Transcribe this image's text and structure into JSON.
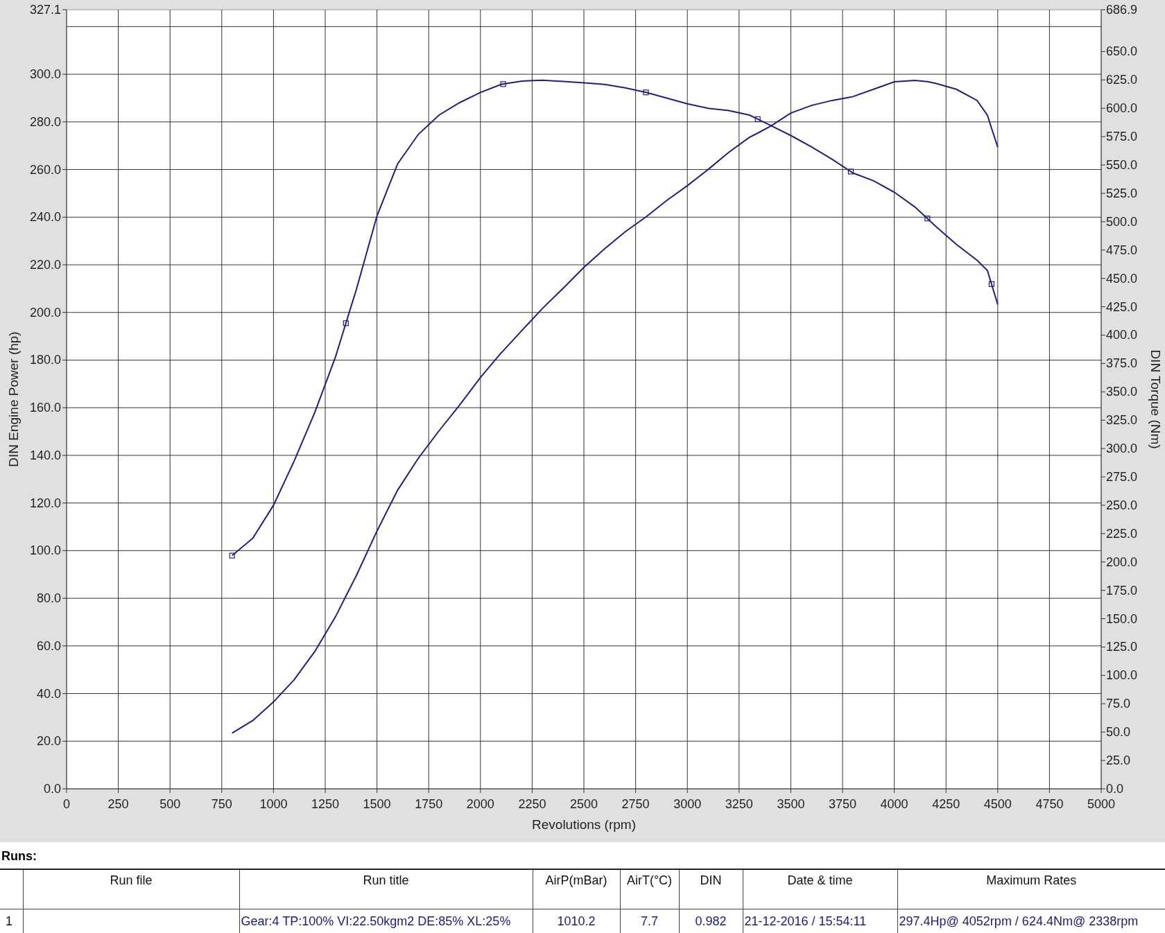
{
  "chart": {
    "chart_data": {
      "type": "line",
      "grid": true,
      "xlabel": "Revolutions (rpm)",
      "ylabel": "DIN Engine Power (hp)",
      "y2label": "DIN Torque (Nm)",
      "x": [
        800,
        900,
        1000,
        1100,
        1200,
        1300,
        1350,
        1400,
        1500,
        1600,
        1700,
        1800,
        1900,
        2000,
        2100,
        2110,
        2200,
        2300,
        2400,
        2500,
        2600,
        2700,
        2800,
        2900,
        3000,
        3100,
        3200,
        3300,
        3340,
        3400,
        3500,
        3600,
        3700,
        3790,
        3800,
        3900,
        4000,
        4100,
        4160,
        4200,
        4300,
        4400,
        4450,
        4470,
        4500
      ],
      "series": [
        {
          "axis": "y2",
          "color": "#1f1f7a",
          "values": [
            205.6,
            221,
            250,
            289,
            332,
            381,
            410.5,
            440,
            505,
            551,
            577,
            594,
            605,
            614,
            621,
            621.3,
            624,
            624.7,
            623.7,
            622.5,
            621,
            618,
            614,
            609,
            604,
            600,
            598,
            594,
            590.4,
            585,
            576,
            566,
            555,
            544.2,
            543,
            536,
            526,
            513,
            502.8,
            496,
            480,
            466,
            457,
            445,
            427
          ]
        },
        {
          "color": "#1f1f7a",
          "values": [
            23.4,
            28.7,
            36.5,
            45.8,
            57.7,
            72.3,
            80.9,
            89.5,
            108.2,
            125.4,
            138.8,
            150.3,
            161.2,
            172.7,
            183,
            183.9,
            192.4,
            201.7,
            210.2,
            218.9,
            226.7,
            233.9,
            240.1,
            247,
            253.2,
            260,
            267.2,
            273.5,
            275.3,
            278.1,
            283.7,
            286.9,
            289,
            290.4,
            290.6,
            293.7,
            296.8,
            297.4,
            296.9,
            296.2,
            293.7,
            289,
            282.8,
            277.4,
            269.4
          ]
        },
        {
          "type": "scatter",
          "axis": "y2",
          "color": "#1f1f7a",
          "values": [
            205.6,
            null,
            null,
            null,
            null,
            null,
            410.5,
            null,
            null,
            null,
            null,
            null,
            null,
            null,
            null,
            621.3,
            null,
            null,
            null,
            null,
            null,
            null,
            614,
            null,
            null,
            null,
            null,
            null,
            590.4,
            null,
            null,
            null,
            null,
            544.2,
            null,
            null,
            null,
            null,
            502.8,
            null,
            null,
            null,
            null,
            445,
            null
          ]
        }
      ],
      "xlim": [
        0,
        5000
      ],
      "ylim": [
        0,
        327.1
      ],
      "y2lim": [
        0,
        686.9
      ],
      "xticks": [
        0,
        250,
        500,
        750,
        1000,
        1250,
        1500,
        1750,
        2000,
        2250,
        2500,
        2750,
        3000,
        3250,
        3500,
        3750,
        4000,
        4250,
        4500,
        4750,
        5000
      ],
      "yticks": [
        {
          "value": 0,
          "label": "0.0"
        },
        {
          "value": 20,
          "label": "20.0"
        },
        {
          "value": 40,
          "label": "40.0"
        },
        {
          "value": 60,
          "label": "60.0"
        },
        {
          "value": 80,
          "label": "80.0"
        },
        {
          "value": 100,
          "label": "100.0"
        },
        {
          "value": 120,
          "label": "120.0"
        },
        {
          "value": 140,
          "label": "140.0"
        },
        {
          "value": 160,
          "label": "160.0"
        },
        {
          "value": 180,
          "label": "180.0"
        },
        {
          "value": 200,
          "label": "200.0"
        },
        {
          "value": 220,
          "label": "220.0"
        },
        {
          "value": 240,
          "label": "240.0"
        },
        {
          "value": 260,
          "label": "260.0"
        },
        {
          "value": 280,
          "label": "280.0"
        },
        {
          "value": 300,
          "label": "300.0"
        },
        {
          "value": 327.1,
          "label": "327.1"
        }
      ],
      "y2ticks": [
        {
          "value": 0,
          "label": "0.0"
        },
        {
          "value": 25,
          "label": "25.0"
        },
        {
          "value": 50,
          "label": "50.0"
        },
        {
          "value": 75,
          "label": "75.0"
        },
        {
          "value": 100,
          "label": "100.0"
        },
        {
          "value": 125,
          "label": "125.0"
        },
        {
          "value": 150,
          "label": "150.0"
        },
        {
          "value": 175,
          "label": "175.0"
        },
        {
          "value": 200,
          "label": "200.0"
        },
        {
          "value": 225,
          "label": "225.0"
        },
        {
          "value": 250,
          "label": "250.0"
        },
        {
          "value": 275,
          "label": "275.0"
        },
        {
          "value": 300,
          "label": "300.0"
        },
        {
          "value": 325,
          "label": "325.0"
        },
        {
          "value": 350,
          "label": "350.0"
        },
        {
          "value": 375,
          "label": "375.0"
        },
        {
          "value": 400,
          "label": "400.0"
        },
        {
          "value": 425,
          "label": "425.0"
        },
        {
          "value": 450,
          "label": "450.0"
        },
        {
          "value": 475,
          "label": "475.0"
        },
        {
          "value": 500,
          "label": "500.0"
        },
        {
          "value": 525,
          "label": "525.0"
        },
        {
          "value": 550,
          "label": "550.0"
        },
        {
          "value": 575,
          "label": "575.0"
        },
        {
          "value": 600,
          "label": "600.0"
        },
        {
          "value": 625,
          "label": "625.0"
        },
        {
          "value": 650,
          "label": "650.0"
        },
        {
          "value": 686.9,
          "label": "686.9"
        }
      ]
    }
  },
  "runs": {
    "title": "Runs:",
    "columns": [
      "",
      "Run file",
      "Run title",
      "AirP(mBar)",
      "AirT(°C)",
      "DIN",
      "Date & time",
      "Maximum Rates"
    ],
    "rows": [
      {
        "cells": [
          "1",
          "",
          "Gear:4 TP:100% VI:22.50kgm2 DE:85% XL:25%",
          "1010.2",
          "7.7",
          "0.982",
          "21-12-2016 / 15:54:11",
          "297.4Hp@ 4052rpm / 624.4Nm@ 2338rpm"
        ]
      }
    ]
  }
}
